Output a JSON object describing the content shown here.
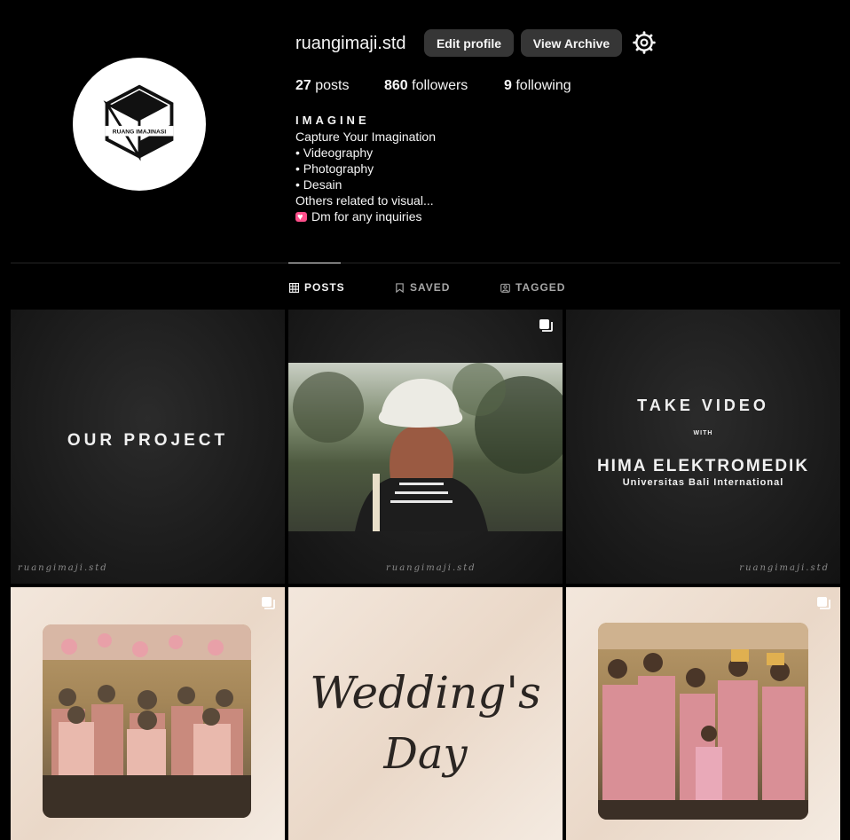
{
  "profile": {
    "username": "ruangimaji.std",
    "avatar_logo_text": "RUANG IMAJINASI",
    "edit_label": "Edit profile",
    "archive_label": "View Archive",
    "stats": {
      "posts_count": "27",
      "posts_label": "posts",
      "followers_count": "860",
      "followers_label": "followers",
      "following_count": "9",
      "following_label": "following"
    },
    "bio": {
      "name": "IMAGINE",
      "line1": "Capture Your Imagination",
      "line2": "• Videography",
      "line3": "• Photography",
      "line4": "• Desain",
      "line5": "Others related to visual...",
      "line6": "Dm for any inquiries"
    }
  },
  "tabs": {
    "posts": "POSTS",
    "saved": "SAVED",
    "tagged": "TAGGED"
  },
  "posts": {
    "p1_title": "OUR PROJECT",
    "p1_signature": "ruangimaji.std",
    "p2_signature": "ruangimaji.std",
    "p3_line1": "TAKE VIDEO",
    "p3_line2": "WITH",
    "p3_line3": "HIMA ELEKTROMEDIK",
    "p3_line4": "Universitas Bali International",
    "p3_signature": "ruangimaji.std",
    "p5_line1": "Wedding's",
    "p5_line2": "Day"
  },
  "colors": {
    "background": "#000000",
    "button": "#363636",
    "text": "#f5f5f5",
    "muted": "#a8a8a8",
    "accent_heart": "#ff4f8b"
  },
  "icons": {
    "settings": "gear-icon",
    "posts_tab": "grid-icon",
    "saved_tab": "bookmark-icon",
    "tagged_tab": "tag-person-icon",
    "multi_post": "carousel-icon"
  }
}
